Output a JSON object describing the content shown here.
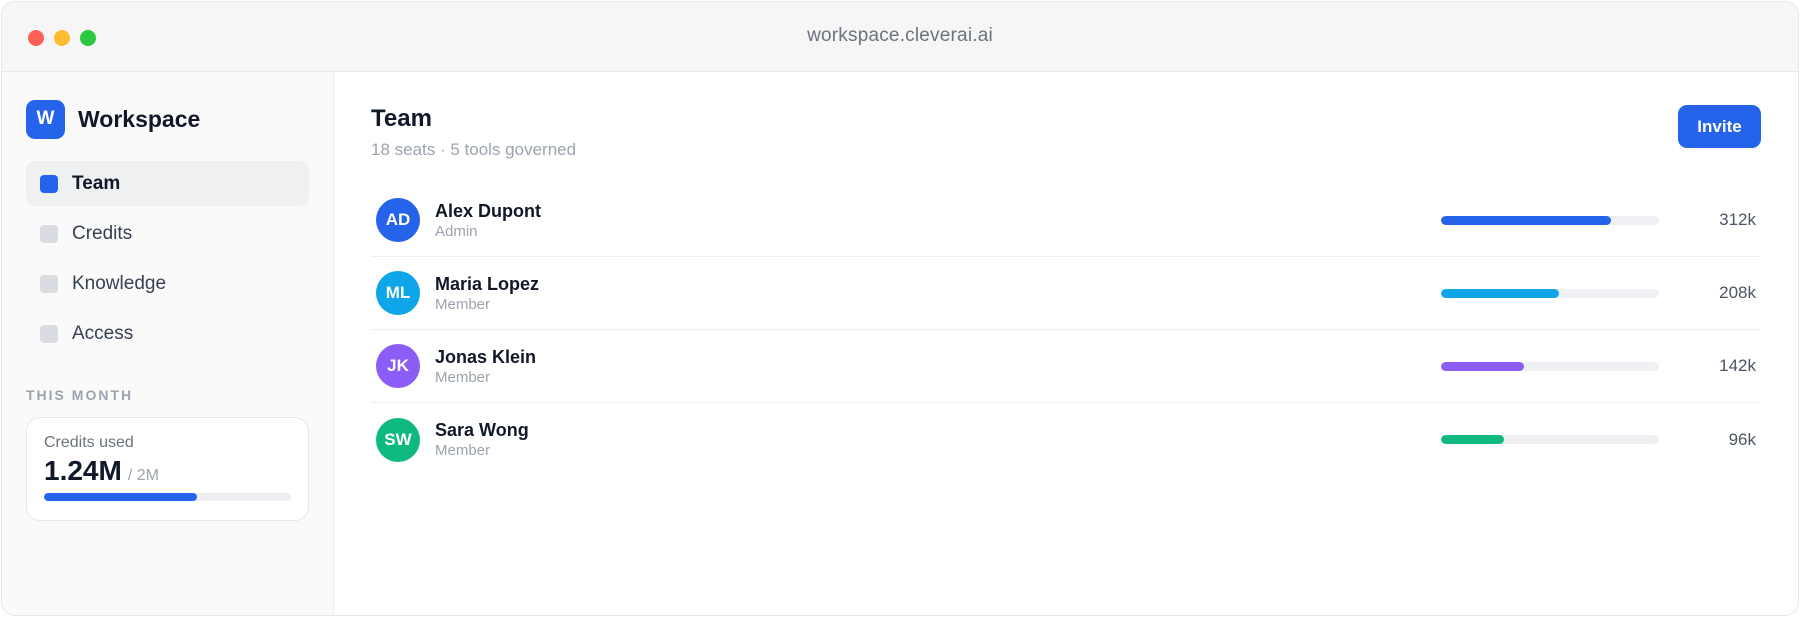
{
  "window": {
    "url": "workspace.cleverai.ai"
  },
  "sidebar": {
    "brand_initial": "W",
    "brand_name": "Workspace",
    "items": [
      {
        "label": "Team",
        "active": true
      },
      {
        "label": "Credits",
        "active": false
      },
      {
        "label": "Knowledge",
        "active": false
      },
      {
        "label": "Access",
        "active": false
      }
    ],
    "section_label": "THIS MONTH",
    "credits": {
      "label": "Credits used",
      "value": "1.24M",
      "total": "/ 2M",
      "fraction_used": 0.62
    }
  },
  "main": {
    "title": "Team",
    "subtitle": "18 seats · 5 tools governed",
    "invite_label": "Invite",
    "members": [
      {
        "initials": "AD",
        "name": "Alex Dupont",
        "role": "Admin",
        "usage": "312k",
        "usage_fraction": 0.78,
        "color": "#2563eb"
      },
      {
        "initials": "ML",
        "name": "Maria Lopez",
        "role": "Member",
        "usage": "208k",
        "usage_fraction": 0.54,
        "color": "#0ea5e9"
      },
      {
        "initials": "JK",
        "name": "Jonas Klein",
        "role": "Member",
        "usage": "142k",
        "usage_fraction": 0.38,
        "color": "#8b5cf6"
      },
      {
        "initials": "SW",
        "name": "Sara Wong",
        "role": "Member",
        "usage": "96k",
        "usage_fraction": 0.29,
        "color": "#10b981"
      }
    ]
  }
}
